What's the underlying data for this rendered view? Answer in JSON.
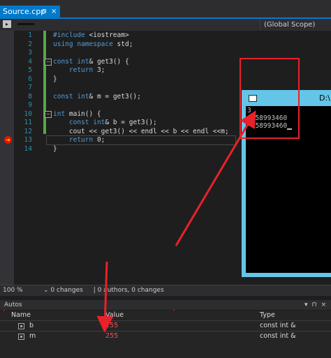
{
  "tab": {
    "label": "Source.cpp",
    "pin": "⊓",
    "close": "×"
  },
  "nav": {
    "scope_icon": "▸",
    "scope": "(Global Scope)"
  },
  "editor": {
    "lines": [
      {
        "n": "1",
        "text": "#include <iostream>"
      },
      {
        "n": "2",
        "text": "using namespace std;"
      },
      {
        "n": "3",
        "text": ""
      },
      {
        "n": "4",
        "text": "const int& get3() {"
      },
      {
        "n": "5",
        "text": "    return 3;"
      },
      {
        "n": "6",
        "text": "}"
      },
      {
        "n": "7",
        "text": ""
      },
      {
        "n": "8",
        "text": "const int& m = get3();"
      },
      {
        "n": "9",
        "text": ""
      },
      {
        "n": "10",
        "text": "int main() {"
      },
      {
        "n": "11",
        "text": "    const int& b = get3();"
      },
      {
        "n": "12",
        "text": "    cout << get3() << endl << b << endl <<m;"
      },
      {
        "n": "13",
        "text": "    return 0;"
      },
      {
        "n": "14",
        "text": "}"
      }
    ]
  },
  "console": {
    "title": "D:\\",
    "output": [
      "3",
      "-858993460",
      "-858993460"
    ]
  },
  "status": {
    "zoom": "100 %",
    "changes": "0 changes",
    "authors": "0 authors, 0 changes"
  },
  "autos": {
    "title": "Autos",
    "columns": [
      "Name",
      "Value",
      "Type"
    ],
    "rows": [
      {
        "name": "b",
        "value": "255",
        "type": "const int &"
      },
      {
        "name": "m",
        "value": "255",
        "type": "const int &"
      }
    ]
  },
  "colors": {
    "accent": "#007acc",
    "highlight": "#e8212b",
    "console_frame": "#63c6e8"
  }
}
